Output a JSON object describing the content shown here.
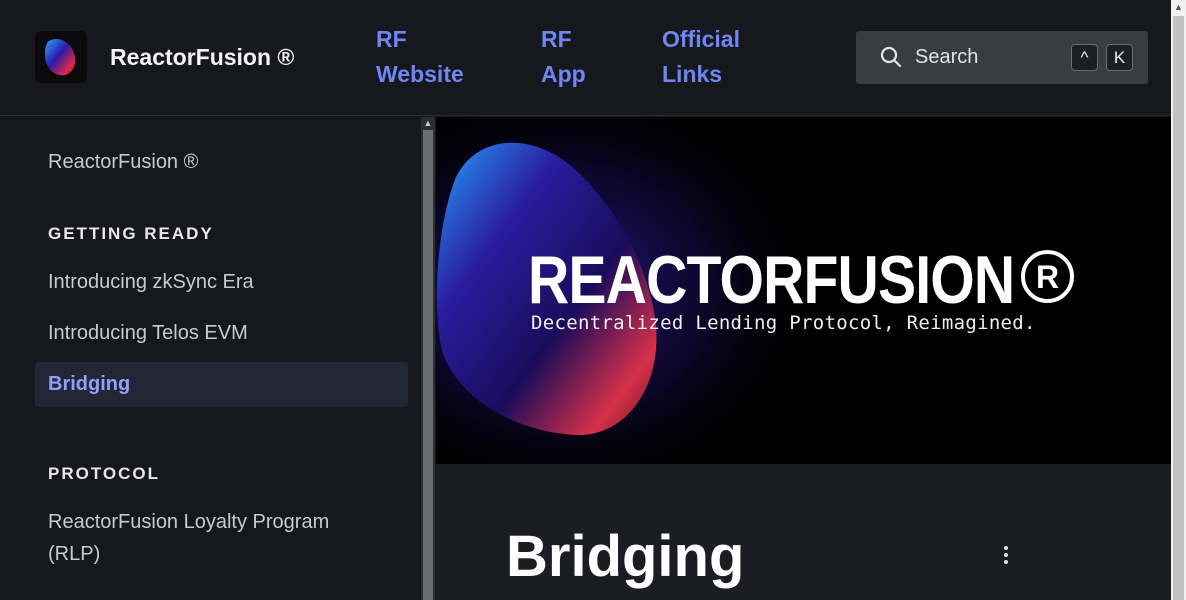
{
  "header": {
    "site_title": "ReactorFusion ®",
    "nav": [
      {
        "line1": "RF",
        "line2": "Website"
      },
      {
        "line1": "RF",
        "line2": "App"
      },
      {
        "line1": "Official",
        "line2": "Links"
      }
    ],
    "search": {
      "label": "Search",
      "shortcut_modifier": "^",
      "shortcut_key": "K"
    }
  },
  "sidebar": {
    "top_item": "ReactorFusion ®",
    "sections": [
      {
        "title": "GETTING READY",
        "items": [
          "Introducing zkSync Era",
          "Introducing Telos EVM",
          "Bridging"
        ]
      },
      {
        "title": "PROTOCOL",
        "items": [
          "ReactorFusion Loyalty Program",
          "(RLP)"
        ]
      }
    ],
    "active_item": "Bridging"
  },
  "hero": {
    "title": "REACTORFUSION",
    "registered_mark": "R",
    "subtitle": "Decentralized Lending Protocol, Reimagined."
  },
  "page": {
    "title": "Bridging"
  },
  "colors": {
    "accent": "#6f87f5",
    "active_bg": "#232634",
    "background": "#16181e"
  },
  "icons": [
    "search-icon",
    "more-options-icon",
    "logo-icon"
  ]
}
